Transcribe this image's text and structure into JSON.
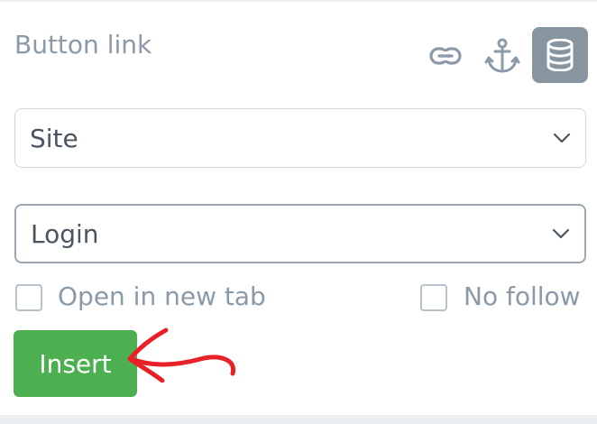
{
  "section": {
    "title": "Button link"
  },
  "link_type_icons": {
    "link": "link-icon",
    "anchor": "anchor-icon",
    "database": "database-icon"
  },
  "selects": {
    "site": {
      "value": "Site"
    },
    "page": {
      "value": "Login"
    }
  },
  "options": {
    "new_tab": {
      "label": "Open in new tab",
      "checked": false
    },
    "no_follow": {
      "label": "No follow",
      "checked": false
    }
  },
  "actions": {
    "insert_label": "Insert"
  },
  "colors": {
    "accent_green": "#4caf50",
    "active_icon_bg": "#8795a1",
    "annotation_red": "#e82127"
  }
}
